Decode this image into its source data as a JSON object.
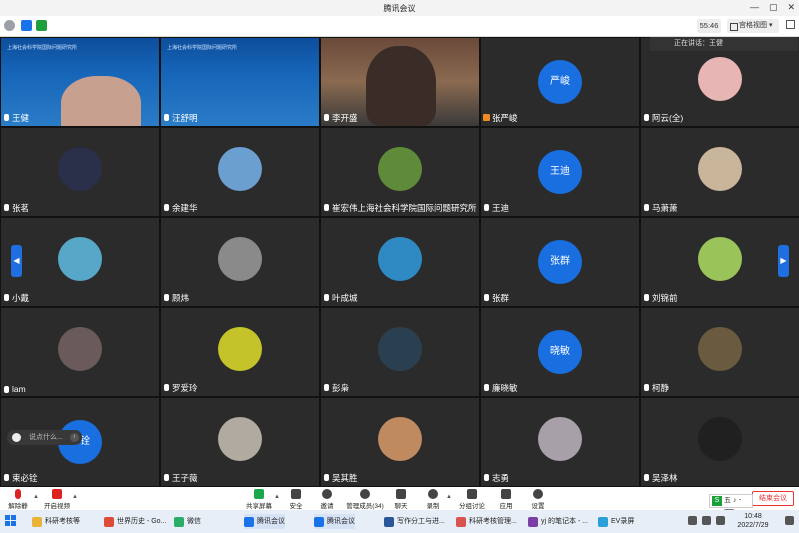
{
  "window": {
    "title": "腾讯会议"
  },
  "topbar": {
    "timer": "55:46",
    "view_label": "宫格视图"
  },
  "speaking": "正在讲话：王健",
  "participants": [
    {
      "name": "王健",
      "type": "video"
    },
    {
      "name": "汪舒明",
      "type": "video"
    },
    {
      "name": "李开盛",
      "type": "video"
    },
    {
      "name": "张严峻",
      "type": "text",
      "avatar_text": "严峻"
    },
    {
      "name": "阿云(全)",
      "type": "image",
      "color": "#e8b5b5"
    },
    {
      "name": "张茗",
      "type": "image",
      "color": "#2a2f4a"
    },
    {
      "name": "余建华",
      "type": "image",
      "color": "#6a9fd0"
    },
    {
      "name": "崔宏伟上海社会科学院国际问题研究所",
      "type": "image",
      "color": "#5e8a3a"
    },
    {
      "name": "王迪",
      "type": "text",
      "avatar_text": "王迪"
    },
    {
      "name": "马萧萧",
      "type": "image",
      "color": "#c9b59a"
    },
    {
      "name": "小戴",
      "type": "image",
      "color": "#56a7c8"
    },
    {
      "name": "顾炜",
      "type": "image",
      "color": "#8a8a8a"
    },
    {
      "name": "叶成城",
      "type": "image",
      "color": "#2f8ac4"
    },
    {
      "name": "张群",
      "type": "text",
      "avatar_text": "张群"
    },
    {
      "name": "刘锦前",
      "type": "image",
      "color": "#9ac45a"
    },
    {
      "name": "lam",
      "type": "image",
      "color": "#6b5a5a"
    },
    {
      "name": "罗爱玲",
      "type": "image",
      "color": "#c4c42a"
    },
    {
      "name": "彭枭",
      "type": "image",
      "color": "#2a4050"
    },
    {
      "name": "廉晓敏",
      "type": "text",
      "avatar_text": "晓敏"
    },
    {
      "name": "柯静",
      "type": "image",
      "color": "#6a5a40"
    },
    {
      "name": "束必铨",
      "type": "text",
      "avatar_text": "必铨"
    },
    {
      "name": "王子薇",
      "type": "image",
      "color": "#b0aaa0"
    },
    {
      "name": "吴其胜",
      "type": "image",
      "color": "#c08a60"
    },
    {
      "name": "志勇",
      "type": "image",
      "color": "#a8a0a8"
    },
    {
      "name": "吴泽林",
      "type": "image",
      "color": "#202020"
    }
  ],
  "banner_text": "上海社会科学院国际问题研究所",
  "chat_placeholder": "说点什么...",
  "controls": {
    "unmute": "解除静音",
    "start_video": "开启视频",
    "share": "共享屏幕",
    "security": "安全",
    "invite": "邀请",
    "members": "管理成员(34)",
    "chat": "聊天",
    "record": "录制",
    "breakout": "分组讨论",
    "apps": "应用",
    "settings": "设置",
    "end": "结束会议"
  },
  "ime": "五",
  "taskbar": {
    "items": [
      {
        "label": "科研考核等",
        "color": "#e9b33a"
      },
      {
        "label": "世界历史 - Go...",
        "color": "#dd4b39"
      },
      {
        "label": "微信",
        "color": "#2aae67"
      },
      {
        "label": "腾讯会议",
        "color": "#1a73e8"
      },
      {
        "label": "腾讯会议",
        "color": "#1a73e8"
      },
      {
        "label": "写作分工与进...",
        "color": "#2b579a"
      },
      {
        "label": "科研考核管理...",
        "color": "#d9534f"
      },
      {
        "label": "yj 的笔记本 - ...",
        "color": "#7b3fa8"
      },
      {
        "label": "EV录屏",
        "color": "#29a0d8"
      }
    ],
    "time": "10:48",
    "date": "2022/7/29"
  }
}
